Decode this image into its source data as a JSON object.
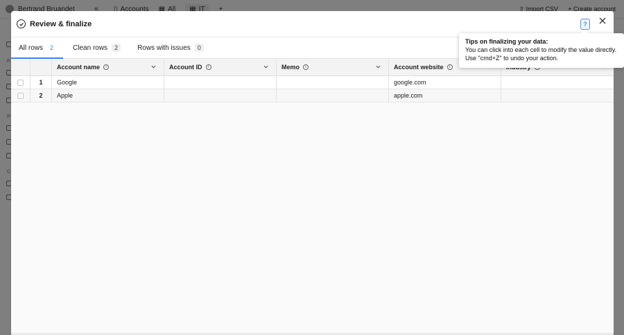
{
  "background": {
    "workspace_name": "Bertrand Bruandet",
    "tabs": [
      {
        "label": "Accounts"
      },
      {
        "label": "All"
      },
      {
        "label": "IT"
      }
    ],
    "actions": {
      "import_csv": "Import CSV",
      "create_account": "Create account"
    },
    "sidebar_letters": [
      "R",
      "R",
      "C"
    ]
  },
  "modal": {
    "title": "Review & finalize",
    "help_glyph": "?",
    "tabs": [
      {
        "label": "All rows",
        "count": "2"
      },
      {
        "label": "Clean rows",
        "count": "2"
      },
      {
        "label": "Rows with issues",
        "count": "0"
      }
    ],
    "columns": [
      {
        "label": "Account name"
      },
      {
        "label": "Account ID"
      },
      {
        "label": "Memo"
      },
      {
        "label": "Account website"
      },
      {
        "label": "Industry"
      }
    ],
    "rows": [
      {
        "num": "1",
        "cells": [
          "Google",
          "",
          "",
          "google.com",
          ""
        ]
      },
      {
        "num": "2",
        "cells": [
          "Apple",
          "",
          "",
          "apple.com",
          ""
        ]
      }
    ]
  },
  "tooltip": {
    "title": "Tips on finalizing your data:",
    "line1": "You can click into each cell to modify the value directly.",
    "line2": "Use \"cmd+Z\" to undo your action."
  },
  "colors": {
    "accent": "#3b82f6",
    "help": "#5a8fd8"
  }
}
